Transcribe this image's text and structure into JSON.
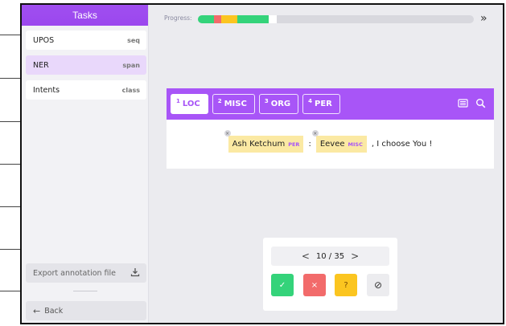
{
  "sidebar": {
    "title": "Tasks",
    "tasks": [
      {
        "name": "UPOS",
        "type": "seq"
      },
      {
        "name": "NER",
        "type": "span"
      },
      {
        "name": "Intents",
        "type": "class"
      }
    ],
    "export_label": "Export annotation file",
    "back_label": "Back"
  },
  "progress": {
    "label": "Progress:",
    "segments": [
      {
        "status": "accepted",
        "color": "#34d37a",
        "fraction": 0.057
      },
      {
        "status": "rejected",
        "color": "#f26b6b",
        "fraction": 0.029
      },
      {
        "status": "ignored",
        "color": "#fbc520",
        "fraction": 0.057
      },
      {
        "status": "accepted",
        "color": "#34d37a",
        "fraction": 0.114
      },
      {
        "status": "current",
        "color": "#ffffff",
        "fraction": 0.029
      }
    ]
  },
  "labels": [
    {
      "key": "1",
      "name": "LOC"
    },
    {
      "key": "2",
      "name": "MISC"
    },
    {
      "key": "3",
      "name": "ORG"
    },
    {
      "key": "4",
      "name": "PER"
    }
  ],
  "sentence": {
    "entity1": {
      "text": "Ash Ketchum",
      "tag": "PER"
    },
    "colon": ":",
    "entity2": {
      "text": "Eevee",
      "tag": "MISC"
    },
    "rest": ", I choose You !"
  },
  "navigation": {
    "position": "10 / 35",
    "prev": "<",
    "next": ">"
  },
  "actions": {
    "accept": "✓",
    "reject": "×",
    "flag": "?",
    "ignore": "⊘"
  },
  "colors": {
    "accent": "#a855f7",
    "accept": "#34d37a",
    "reject": "#f26b6b",
    "flag": "#fbc520"
  }
}
